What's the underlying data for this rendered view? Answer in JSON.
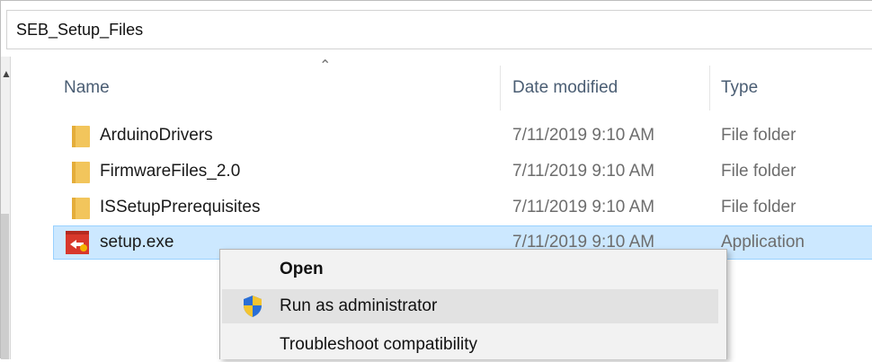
{
  "window": {
    "path": "SEB_Setup_Files"
  },
  "columns": {
    "name": "Name",
    "date": "Date modified",
    "type": "Type"
  },
  "files": [
    {
      "name": "ArduinoDrivers",
      "date": "7/11/2019 9:10 AM",
      "type": "File folder",
      "icon": "folder-icon"
    },
    {
      "name": "FirmwareFiles_2.0",
      "date": "7/11/2019 9:10 AM",
      "type": "File folder",
      "icon": "folder-icon"
    },
    {
      "name": "ISSetupPrerequisites",
      "date": "7/11/2019 9:10 AM",
      "type": "File folder",
      "icon": "folder-icon"
    },
    {
      "name": "setup.exe",
      "date": "7/11/2019 9:10 AM",
      "type": "Application",
      "icon": "exe-icon",
      "selected": true
    }
  ],
  "context_menu": {
    "items": [
      {
        "label": "Open",
        "bold": true
      },
      {
        "label": "Run as administrator",
        "icon": "shield-icon",
        "hover": true
      },
      {
        "label": "Troubleshoot compatibility"
      }
    ]
  },
  "colors": {
    "selection": "#cce8ff",
    "selection_border": "#99d1ff",
    "folder": "#f2c55c",
    "header_text": "#4a5d73"
  }
}
